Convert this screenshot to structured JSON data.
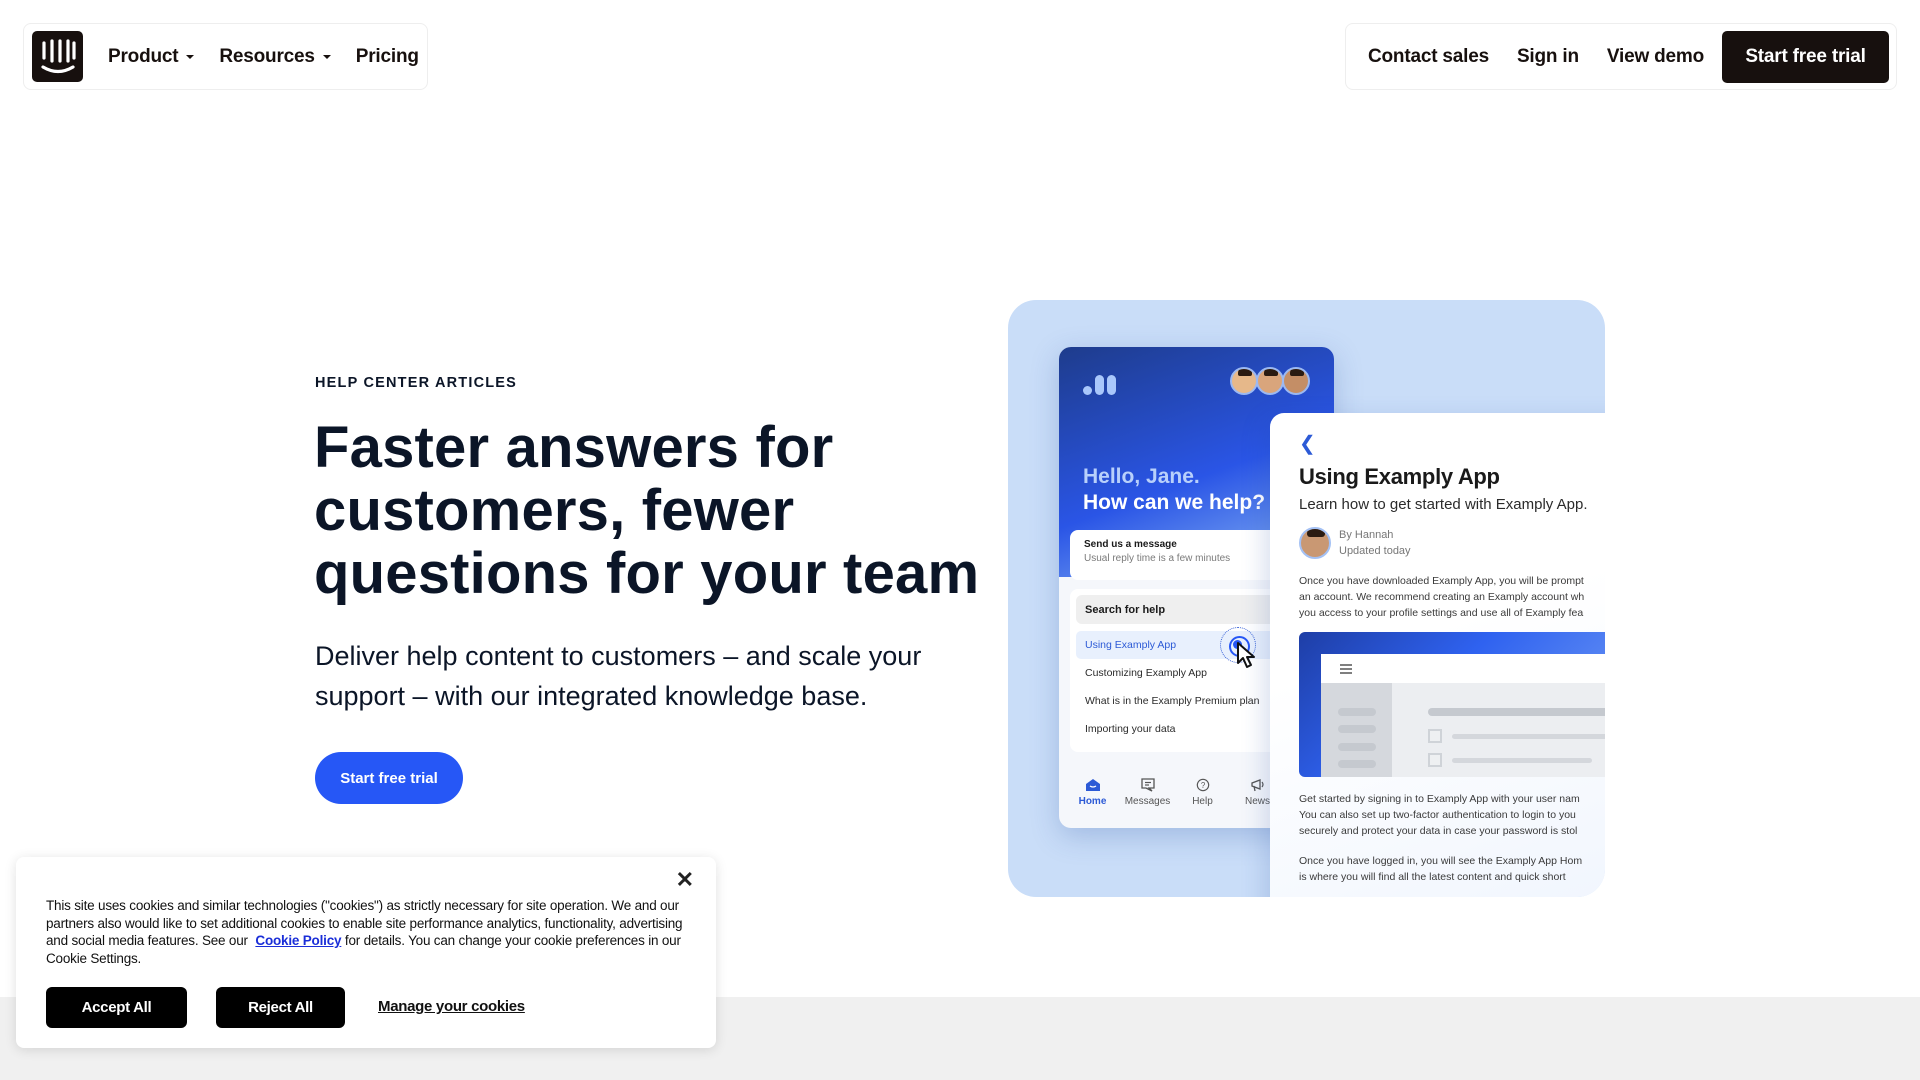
{
  "nav": {
    "left_items": [
      {
        "label": "Product",
        "has_dropdown": true
      },
      {
        "label": "Resources",
        "has_dropdown": true
      },
      {
        "label": "Pricing",
        "has_dropdown": false
      }
    ],
    "right_items": [
      {
        "label": "Contact sales"
      },
      {
        "label": "Sign in"
      },
      {
        "label": "View demo"
      }
    ],
    "cta_label": "Start free trial",
    "logo_icon": "smiley-bars-logo-icon"
  },
  "hero": {
    "eyebrow": "HELP CENTER ARTICLES",
    "title_lines": [
      "Faster answers for",
      "customers, fewer",
      "questions for your team"
    ],
    "subtitle_lines": [
      "Deliver help content to customers – and scale your",
      "support – with our integrated knowledge base."
    ],
    "cta_label": "Start free trial",
    "accent_color": "#2657f6"
  },
  "mockup": {
    "messenger": {
      "greeting_line1": "Hello, Jane.",
      "greeting_line2": "How can we help?",
      "send_title": "Send us a message",
      "send_subtitle": "Usual reply time is a few minutes",
      "search_label": "Search for help",
      "articles": [
        "Using Examply App",
        "Customizing Examply App",
        "What is in the Examply Premium plan",
        "Importing your data"
      ],
      "tabs": [
        {
          "label": "Home",
          "icon": "home-icon",
          "active": true
        },
        {
          "label": "Messages",
          "icon": "messages-icon",
          "active": false
        },
        {
          "label": "Help",
          "icon": "help-icon",
          "active": false
        },
        {
          "label": "News",
          "icon": "megaphone-icon",
          "active": false
        }
      ]
    },
    "article": {
      "title": "Using Examply App",
      "subtitle": "Learn how to get started with Examply App.",
      "author": "By Hannah",
      "updated": "Updated today",
      "para1": [
        "Once you have downloaded Examply App, you will be prompt",
        "an account. We recommend creating an Examply account wh",
        "you access to your profile settings and use all of Examply fea"
      ],
      "para2": [
        "Get started by signing in to Examply App with your user nam",
        "You can also set up two-factor authentication to login to you",
        "securely and protect your data in case your password is stol"
      ],
      "para3": [
        "Once you have logged in, you will see the Examply App Hom",
        "is where you will find all the latest content and quick short"
      ]
    }
  },
  "cookie_banner": {
    "text_before_link": "This site uses cookies and similar technologies (\"cookies\") as strictly necessary for site operation. We and our partners also would like to set additional cookies to enable site performance analytics, functionality, advertising and social media features. See our",
    "link_label": "Cookie Policy",
    "text_after_link": "for details. You can change your cookie preferences in our Cookie Settings.",
    "accept_label": "Accept All",
    "reject_label": "Reject All",
    "manage_label": "Manage your cookies",
    "close_label": "✕"
  }
}
